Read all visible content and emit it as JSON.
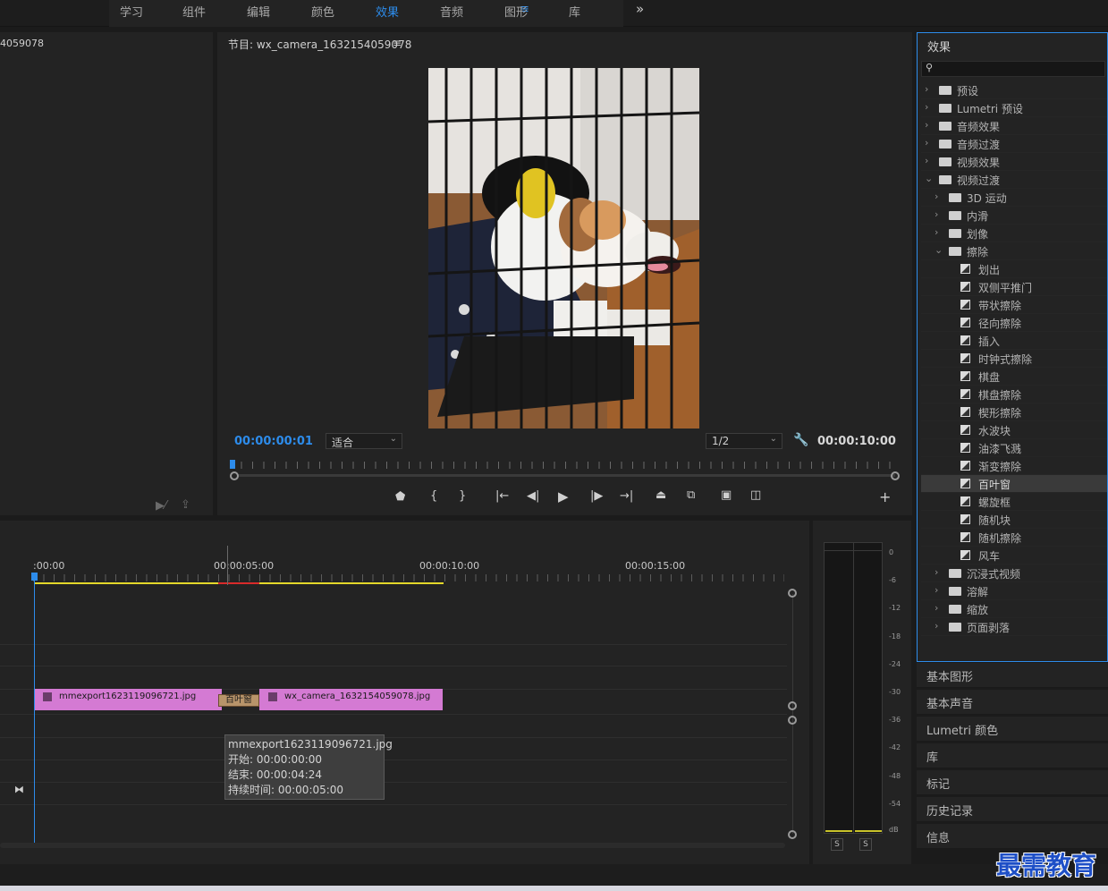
{
  "workspace": {
    "tabs": [
      "学习",
      "组件",
      "编辑",
      "颜色",
      "效果",
      "音频",
      "图形",
      "库"
    ],
    "active_tab": "效果",
    "menu_icon": "hamburger-icon",
    "more_icon": "double-chevron-right-icon"
  },
  "source_panel": {
    "title_fragment": "4059078"
  },
  "program": {
    "title": "节目: wx_camera_1632154059078",
    "timecode_current": "00:00:00:01",
    "zoom_select": "适合",
    "resolution_select": "1/2",
    "timecode_duration": "00:00:10:00",
    "accent": "#2d8ceb"
  },
  "timeline": {
    "ruler_labels": [
      ":00:00",
      "00:00:05:00",
      "00:00:10:00",
      "00:00:15:00"
    ],
    "clips": [
      {
        "name": "mmexport1623119096721.jpg",
        "color": "#d47ad3"
      },
      {
        "name": "wx_camera_1632154059078.jpg",
        "color": "#d47ad3"
      }
    ],
    "transition_label": "百叶窗",
    "tooltip": {
      "name": "mmexport1623119096721.jpg",
      "start": "开始: 00:00:00:00",
      "end": "结束: 00:00:04:24",
      "duration": "持续时间: 00:00:05:00"
    }
  },
  "meters": {
    "scale": [
      "0",
      "-6",
      "-12",
      "-18",
      "-24",
      "-30",
      "-36",
      "-42",
      "-48",
      "-54",
      "dB"
    ],
    "solo_left": "S",
    "solo_right": "S"
  },
  "effects": {
    "title": "效果",
    "search_placeholder": "",
    "items": [
      {
        "label": "预设",
        "type": "preset-folder",
        "level": 0,
        "expanded": false
      },
      {
        "label": "Lumetri 预设",
        "type": "preset-folder",
        "level": 0,
        "expanded": false
      },
      {
        "label": "音频效果",
        "type": "folder",
        "level": 0,
        "expanded": false
      },
      {
        "label": "音频过渡",
        "type": "folder",
        "level": 0,
        "expanded": false
      },
      {
        "label": "视频效果",
        "type": "folder",
        "level": 0,
        "expanded": false
      },
      {
        "label": "视频过渡",
        "type": "folder",
        "level": 0,
        "expanded": true
      },
      {
        "label": "3D 运动",
        "type": "folder",
        "level": 1,
        "expanded": false
      },
      {
        "label": "内滑",
        "type": "folder",
        "level": 1,
        "expanded": false
      },
      {
        "label": "划像",
        "type": "folder",
        "level": 1,
        "expanded": false
      },
      {
        "label": "擦除",
        "type": "folder",
        "level": 1,
        "expanded": true
      },
      {
        "label": "划出",
        "type": "transition",
        "level": 2
      },
      {
        "label": "双侧平推门",
        "type": "transition",
        "level": 2
      },
      {
        "label": "带状擦除",
        "type": "transition",
        "level": 2
      },
      {
        "label": "径向擦除",
        "type": "transition",
        "level": 2
      },
      {
        "label": "插入",
        "type": "transition",
        "level": 2
      },
      {
        "label": "时钟式擦除",
        "type": "transition",
        "level": 2
      },
      {
        "label": "棋盘",
        "type": "transition",
        "level": 2
      },
      {
        "label": "棋盘擦除",
        "type": "transition",
        "level": 2
      },
      {
        "label": "楔形擦除",
        "type": "transition",
        "level": 2
      },
      {
        "label": "水波块",
        "type": "transition",
        "level": 2
      },
      {
        "label": "油漆飞溅",
        "type": "transition",
        "level": 2
      },
      {
        "label": "渐变擦除",
        "type": "transition",
        "level": 2
      },
      {
        "label": "百叶窗",
        "type": "transition",
        "level": 2,
        "selected": true
      },
      {
        "label": "螺旋框",
        "type": "transition",
        "level": 2
      },
      {
        "label": "随机块",
        "type": "transition",
        "level": 2
      },
      {
        "label": "随机擦除",
        "type": "transition",
        "level": 2
      },
      {
        "label": "风车",
        "type": "transition",
        "level": 2
      },
      {
        "label": "沉浸式视频",
        "type": "folder",
        "level": 1,
        "expanded": false
      },
      {
        "label": "溶解",
        "type": "folder",
        "level": 1,
        "expanded": false
      },
      {
        "label": "缩放",
        "type": "folder",
        "level": 1,
        "expanded": false
      },
      {
        "label": "页面剥落",
        "type": "folder",
        "level": 1,
        "expanded": false
      }
    ]
  },
  "side_panels": [
    "基本图形",
    "基本声音",
    "Lumetri 颜色",
    "库",
    "标记",
    "历史记录",
    "信息"
  ],
  "watermark": "最需教育"
}
